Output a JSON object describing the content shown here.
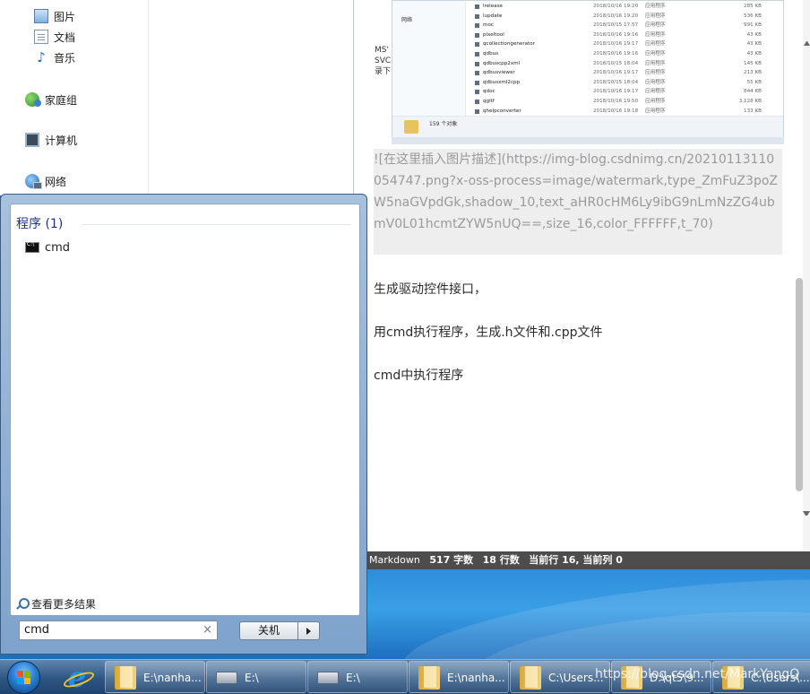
{
  "explorer": {
    "items": [
      {
        "label": "图片",
        "icon": "pictures-icon"
      },
      {
        "label": "文档",
        "icon": "documents-icon"
      },
      {
        "label": "音乐",
        "icon": "music-icon"
      },
      {
        "label": "家庭组",
        "icon": "homegroup-icon"
      },
      {
        "label": "计算机",
        "icon": "computer-icon"
      },
      {
        "label": "网络",
        "icon": "network-icon"
      }
    ]
  },
  "editor": {
    "embedded_screenshot": {
      "side_label": "网络",
      "files": [
        {
          "name": "lrelease",
          "date": "2018/10/16 19:20",
          "type": "应用程序",
          "size": "285 KB"
        },
        {
          "name": "lupdate",
          "date": "2018/10/16 19:20",
          "type": "应用程序",
          "size": "536 KB"
        },
        {
          "name": "moc",
          "date": "2018/10/15 17:57",
          "type": "应用程序",
          "size": "991 KB"
        },
        {
          "name": "pixeltool",
          "date": "2018/10/16 19:16",
          "type": "应用程序",
          "size": "43 KB"
        },
        {
          "name": "qcollectiongenerator",
          "date": "2018/10/16 19:17",
          "type": "应用程序",
          "size": "43 KB"
        },
        {
          "name": "qdbus",
          "date": "2018/10/16 19:16",
          "type": "应用程序",
          "size": "43 KB"
        },
        {
          "name": "qdbuscpp2xml",
          "date": "2018/10/15 18:04",
          "type": "应用程序",
          "size": "145 KB"
        },
        {
          "name": "qdbusviewer",
          "date": "2018/10/16 19:17",
          "type": "应用程序",
          "size": "213 KB"
        },
        {
          "name": "qdbusxml2cpp",
          "date": "2018/10/15 18:04",
          "type": "应用程序",
          "size": "55 KB"
        },
        {
          "name": "qdoc",
          "date": "2018/10/16 19:17",
          "type": "应用程序",
          "size": "844 KB"
        },
        {
          "name": "qgltf",
          "date": "2018/10/16 19:50",
          "type": "应用程序",
          "size": "3,128 KB"
        },
        {
          "name": "qhelpconverter",
          "date": "2018/10/16 19:18",
          "type": "应用程序",
          "size": "133 KB"
        }
      ],
      "count": "159 个对象"
    },
    "cut_text": "MS\nSVC\n录下",
    "markdown_image": "![在这里插入图片描述](https://img-blog.csdnimg.cn/20210113110054747.png?x-oss-process=image/watermark,type_ZmFuZ3poZW5naGVpdGk,shadow_10,text_aHR0cHM6Ly9ibG9nLmNzZG4ubmV0L01hcmtZYW5nUQ==,size_16,color_FFFFFF,t_70)",
    "paragraphs": [
      "生成驱动控件接口，",
      "用cmd执行程序，生成.h文件和.cpp文件",
      "cmd中执行程序"
    ]
  },
  "statusbar": {
    "mode": "Markdown",
    "words": "517 字数",
    "lines": "18 行数",
    "row": "当前行 16, 当前列 0"
  },
  "startmenu": {
    "header": "程序 (1)",
    "result": "cmd",
    "see_more": "查看更多结果",
    "search_value": "cmd",
    "clear": "×",
    "shutdown": "关机"
  },
  "taskbar": {
    "tasks": [
      {
        "label": "E:\\nanha...",
        "icon": "folder-icon"
      },
      {
        "label": "E:\\",
        "icon": "drive-icon"
      },
      {
        "label": "E:\\",
        "icon": "drive-icon"
      },
      {
        "label": "E:\\nanha...",
        "icon": "folder-icon"
      },
      {
        "label": "C:\\Users...",
        "icon": "folder-icon"
      },
      {
        "label": "D:\\qt5\\9...",
        "icon": "folder-icon"
      },
      {
        "label": "C:\\Users\\...",
        "icon": "folder-icon"
      }
    ],
    "watermark": "https://blog.csdn.net/MarkYangQ"
  }
}
